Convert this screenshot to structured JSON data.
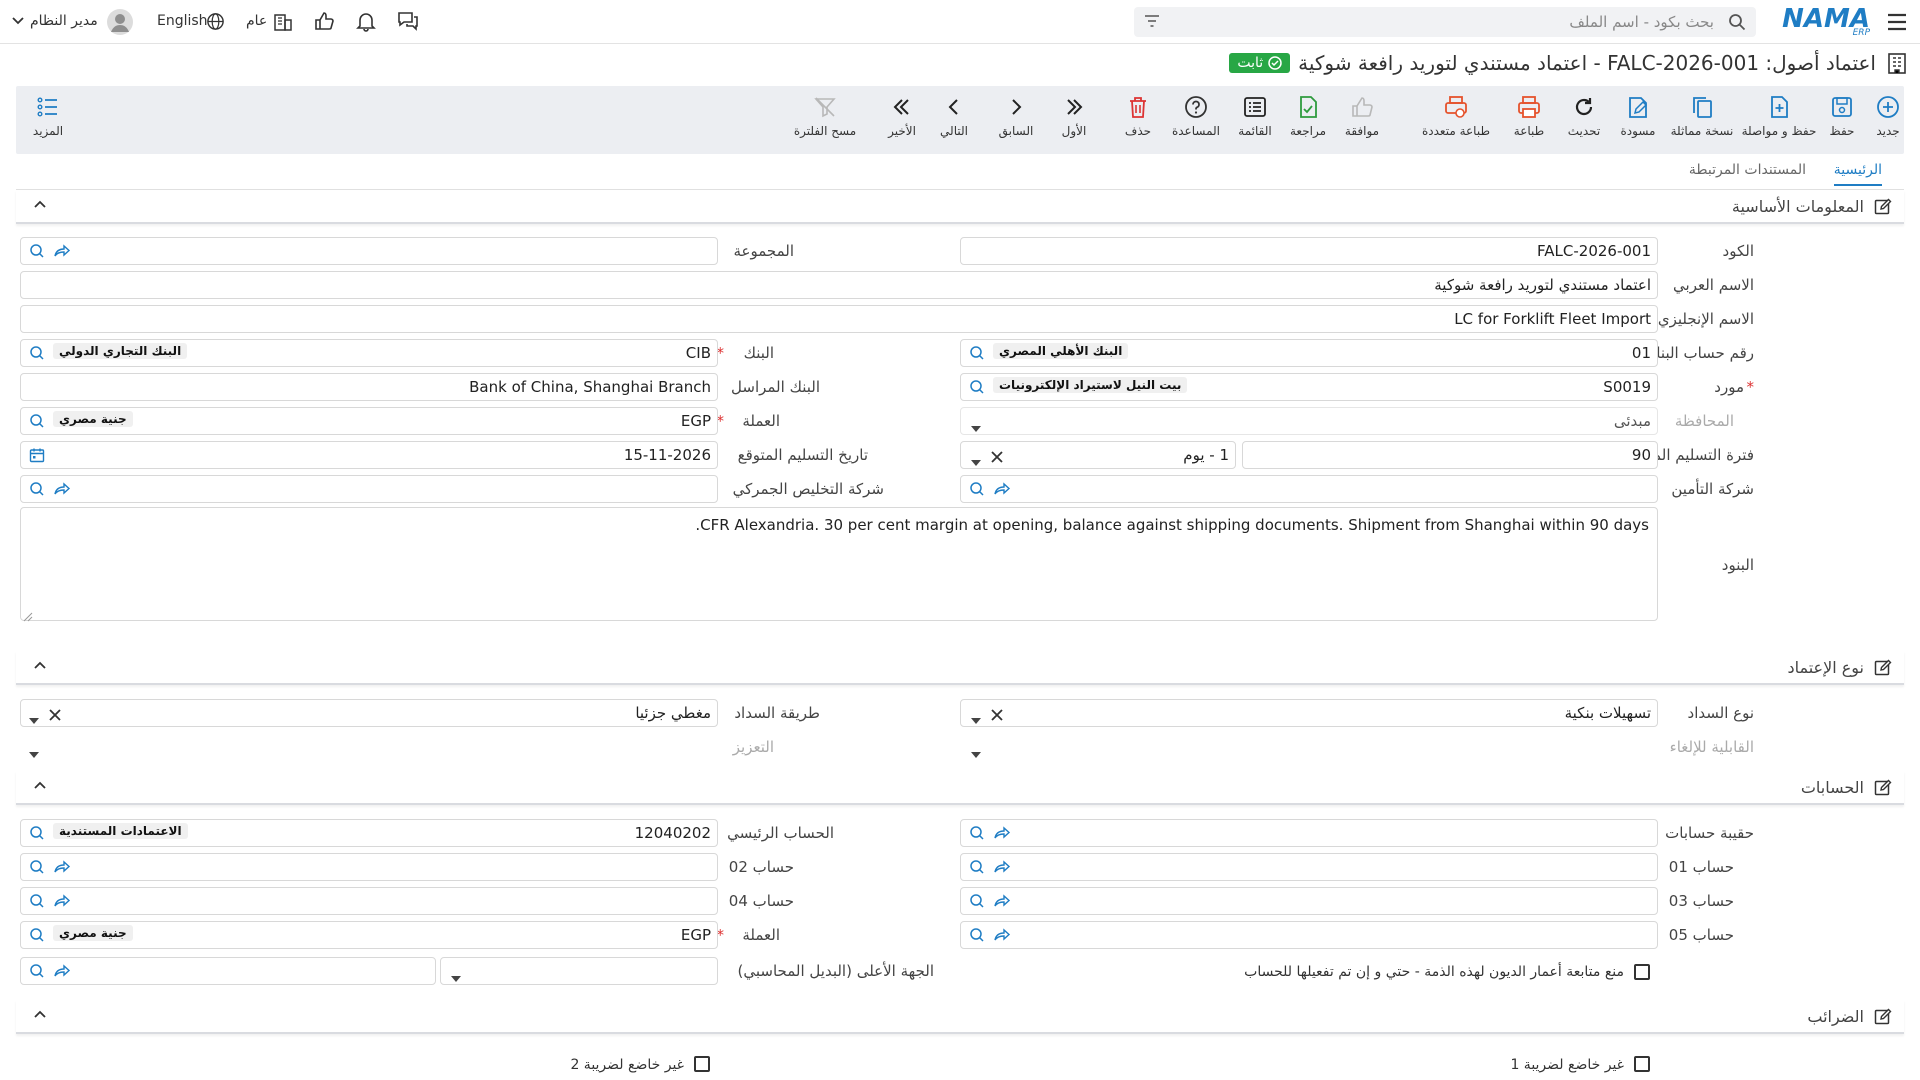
{
  "header": {
    "logo": "NAMA",
    "logo_sub": "ERP",
    "search_placeholder": "بحث بكود - اسم الملف",
    "user_name": "مدير النظام",
    "language": "English",
    "scope": "عام"
  },
  "page": {
    "title": "اعتماد أصول: FALC-2026-001 - اعتماد مستندي لتوريد رافعة شوكية",
    "status_badge": "ثابت"
  },
  "toolbar": {
    "new": "جديد",
    "save": "حفظ",
    "save_continue": "حفظ و مواصلة",
    "copy": "نسخة مماثلة",
    "draft": "مسودة",
    "refresh": "تحديث",
    "print": "طباعة",
    "multi_print": "طباعة متعددة",
    "approve": "موافقة",
    "review": "مراجعة",
    "list": "القائمة",
    "help": "المساعدة",
    "delete": "حذف",
    "first": "الأول",
    "previous": "السابق",
    "next": "التالي",
    "last": "الأخير",
    "clear_filter": "مسح الفلترة",
    "more": "المزيد"
  },
  "tabs": {
    "main": "الرئيسية",
    "related": "المستندات المرتبطة"
  },
  "basic": {
    "title": "المعلومات الأساسية",
    "code_label": "الكود",
    "code_value": "FALC-2026-001",
    "group_label": "المجموعة",
    "arabic_name_label": "الاسم العربي",
    "arabic_name_value": "اعتماد مستندي لتوريد رافعة شوكية",
    "english_name_label": "الاسم الإنجليزي",
    "english_name_value": "LC for Forklift Fleet Import",
    "bank_account_label": "رقم حساب البنك",
    "bank_account_value": "01",
    "bank_account_tag": "البنك الأهلي المصري",
    "bank_label": "البنك",
    "bank_value": "CIB",
    "bank_tag": "البنك التجاري الدولي",
    "supplier_label": "مورد",
    "supplier_value": "S0019",
    "supplier_tag": "بيت النيل لاستيراد الإلكترونيات",
    "correspondent_label": "البنك المراسل",
    "correspondent_value": "Bank of China, Shanghai Branch",
    "governorate_label": "المحافظة",
    "governorate_value": "مبدئى",
    "currency_label": "العملة",
    "currency_value": "EGP",
    "currency_tag": "جنية مصري",
    "delivery_period_label": "فترة التسليم المتوقعة",
    "delivery_period_value": "90",
    "delivery_period_unit": "1 - يوم",
    "delivery_date_label": "تاريخ التسليم المتوقع",
    "delivery_date_value": "15-11-2026",
    "insurance_label": "شركة التأمين",
    "customs_label": "شركة التخليص الجمركي",
    "terms_label": "البنود",
    "terms_value": "CFR Alexandria. 30 per cent margin at opening, balance against shipping documents. Shipment from Shanghai within 90 days."
  },
  "credit_type": {
    "title": "نوع الإعتماد",
    "payment_type_label": "نوع السداد",
    "payment_type_value": "تسهيلات بنكية",
    "payment_method_label": "طريقة السداد",
    "payment_method_value": "مغطي جزئيا",
    "revocability_label": "القابلية للإلغاء",
    "confirmation_label": "التعزيز"
  },
  "accounts": {
    "title": "الحسابات",
    "bag_label": "حقيبة حسابات",
    "main_account_label": "الحساب الرئيسي",
    "main_account_value": "12040202",
    "main_account_tag": "الاعتمادات المستندية",
    "acc01_label": "حساب 01",
    "acc02_label": "حساب 02",
    "acc03_label": "حساب 03",
    "acc04_label": "حساب 04",
    "acc05_label": "حساب 05",
    "currency_label": "العملة",
    "currency_value": "EGP",
    "currency_tag": "جنية مصري",
    "parent_label": "الجهة الأعلى (البديل المحاسبي)",
    "aging_checkbox_label": "منع متابعة أعمار الديون لهذه الذمة - حتي و إن تم تفعيلها للحساب"
  },
  "taxes": {
    "title": "الضرائب",
    "exempt1_label": "غير خاضع لضريبة 1",
    "exempt2_label": "غير خاضع لضريبة 2"
  },
  "colors": {
    "accent": "#1f7dc4",
    "badge": "#28a745",
    "danger": "#d33333",
    "toolbar_bg": "#eceef2"
  }
}
